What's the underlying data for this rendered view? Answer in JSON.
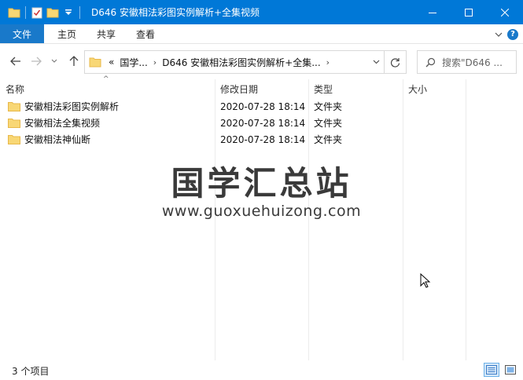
{
  "window": {
    "title": "D646 安徽相法彩图实例解析+全集视频",
    "controls": {
      "minimize_icon": "minimize-icon",
      "maximize_icon": "maximize-icon",
      "close_icon": "close-icon"
    }
  },
  "ribbon": {
    "tabs": [
      "文件",
      "主页",
      "共享",
      "查看"
    ]
  },
  "nav": {
    "breadcrumb_prefix": "«",
    "breadcrumbs": [
      "国学...",
      "D646 安徽相法彩图实例解析+全集..."
    ],
    "search_placeholder": "搜索\"D646 ..."
  },
  "columns": [
    "名称",
    "修改日期",
    "类型",
    "大小"
  ],
  "files": [
    {
      "name": "安徽相法彩图实例解析",
      "date": "2020-07-28 18:14",
      "type": "文件夹",
      "size": ""
    },
    {
      "name": "安徽相法全集视频",
      "date": "2020-07-28 18:14",
      "type": "文件夹",
      "size": ""
    },
    {
      "name": "安徽相法神仙断",
      "date": "2020-07-28 18:14",
      "type": "文件夹",
      "size": ""
    }
  ],
  "watermark": {
    "title": "国学汇总站",
    "url": "www.guoxuehuizong.com"
  },
  "status": {
    "item_count": "3 个项目"
  },
  "colors": {
    "titlebar": "#0078d7",
    "file_tab": "#1979ca",
    "folder": "#f8d775",
    "folder_dark": "#e8b84a"
  }
}
